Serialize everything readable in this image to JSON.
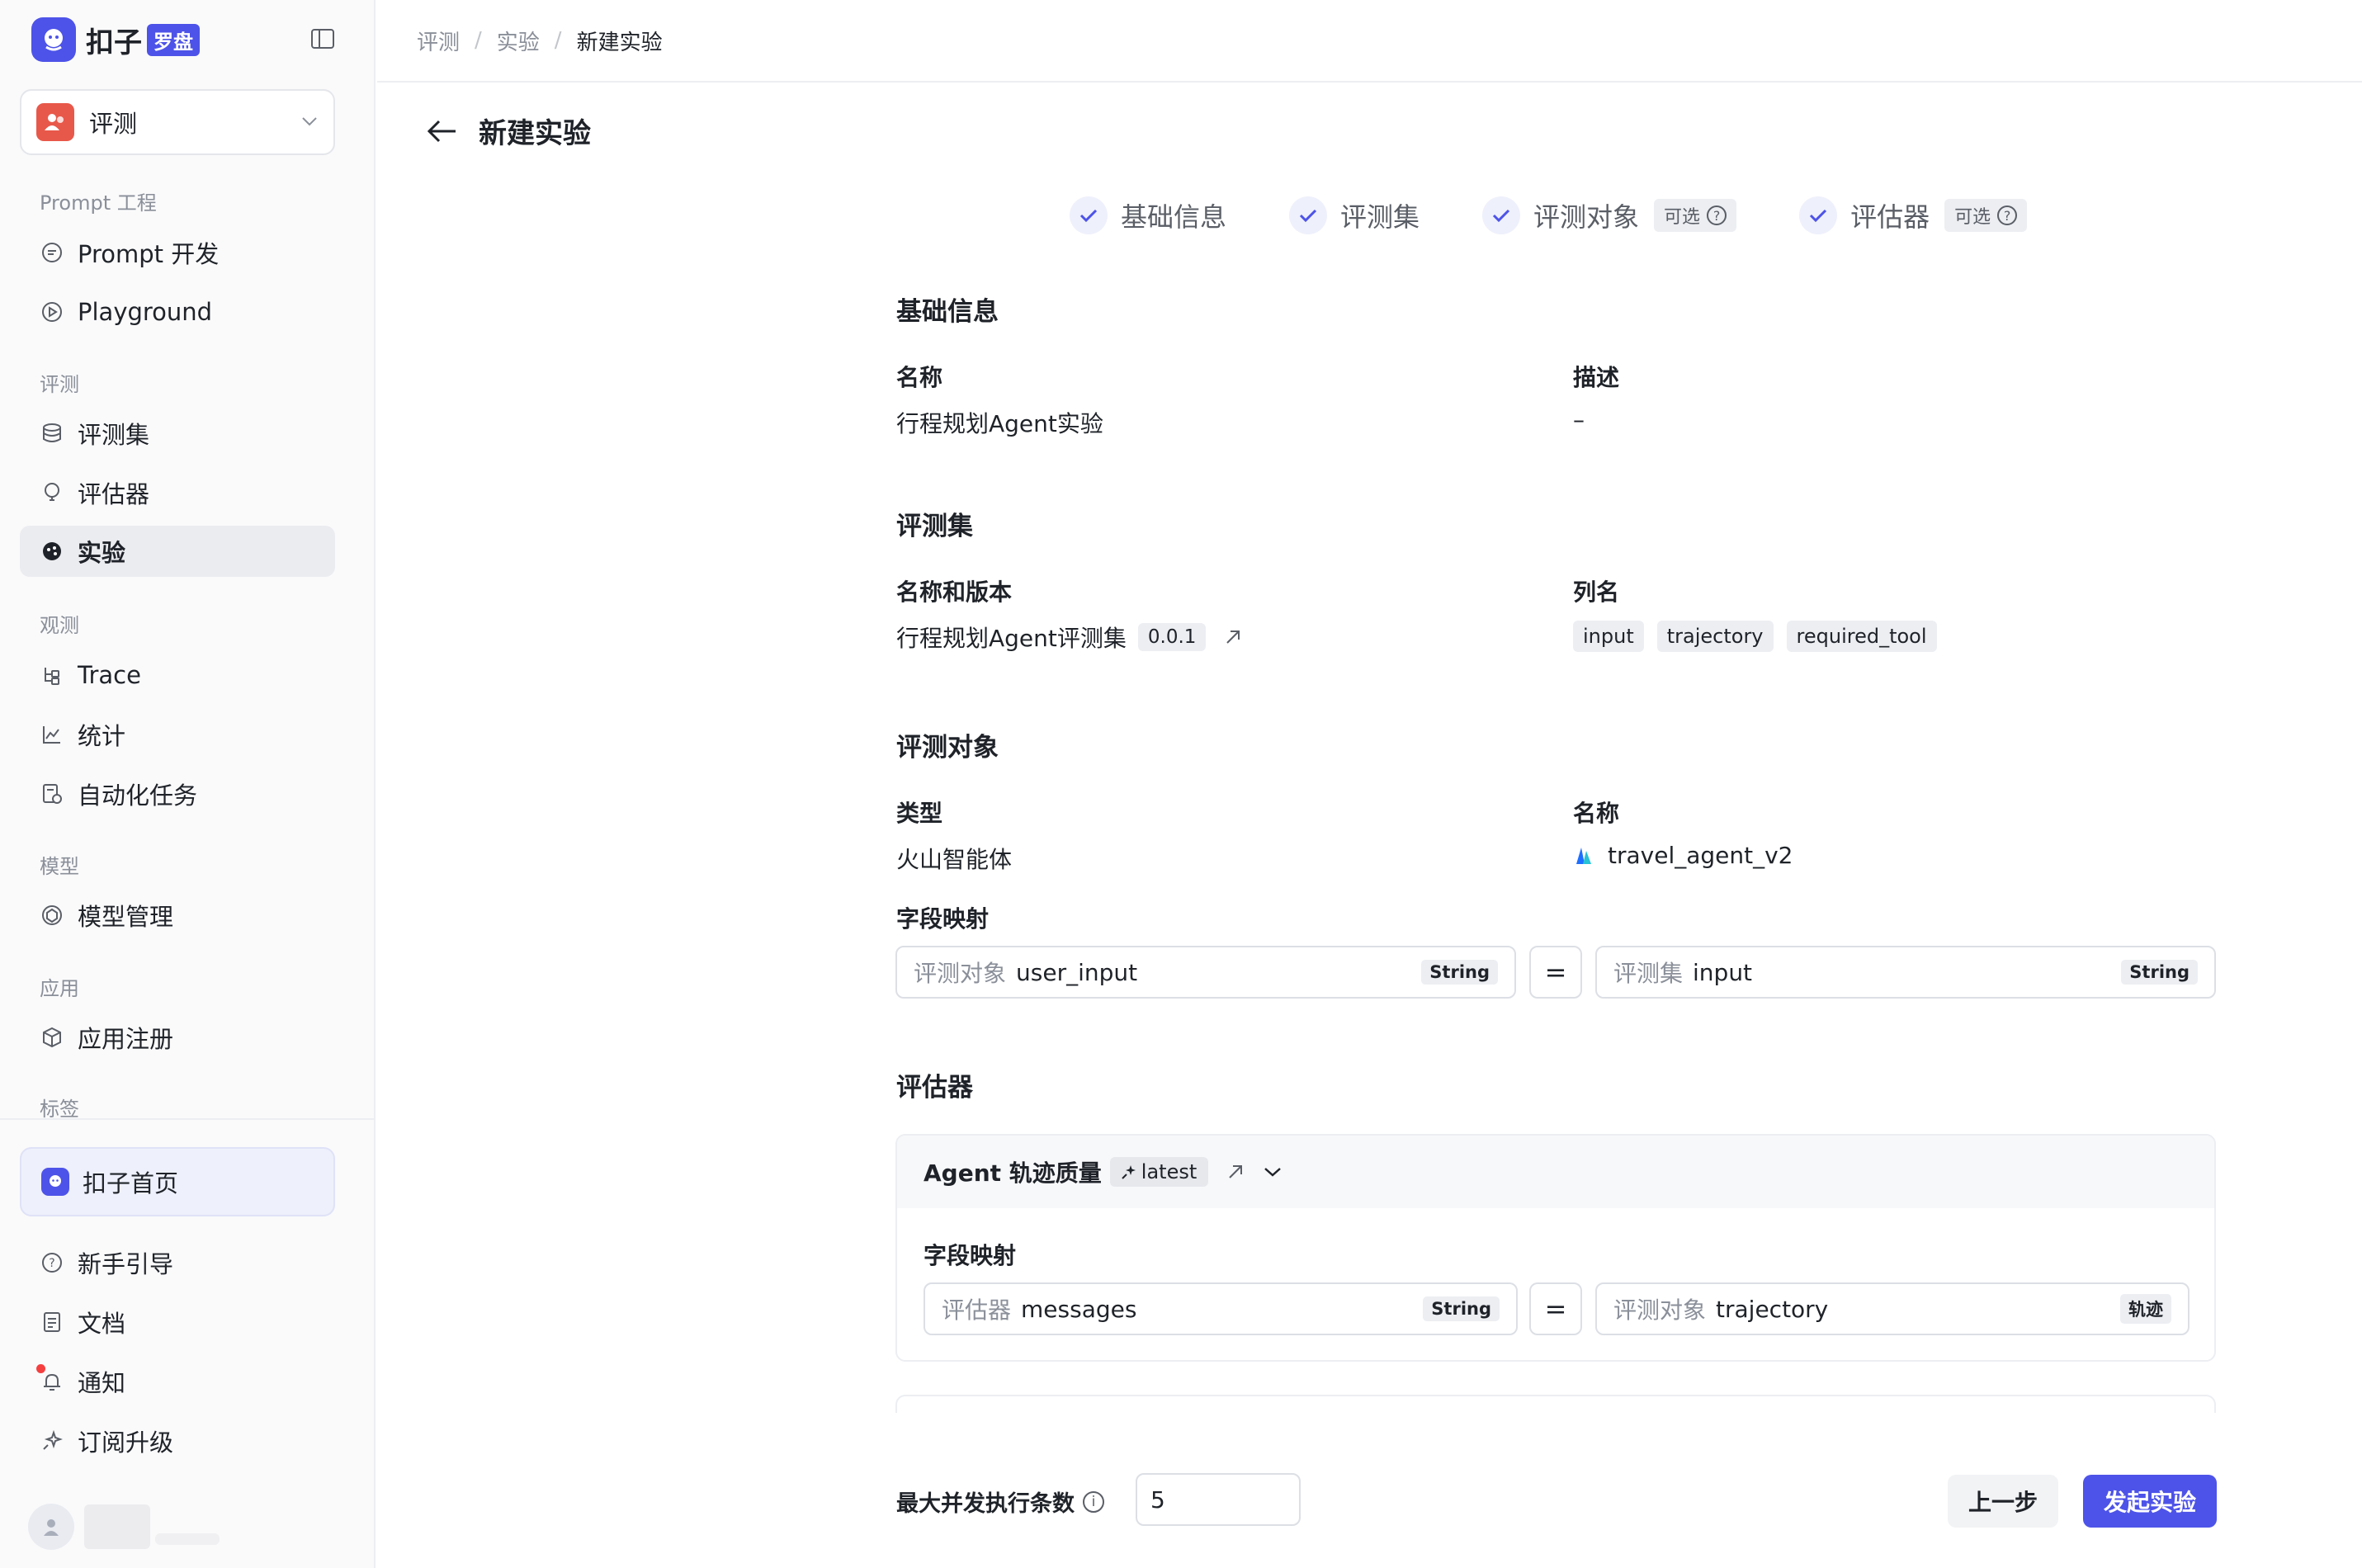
{
  "brand": {
    "name": "扣子",
    "badge": "罗盘"
  },
  "space": {
    "name": "评测"
  },
  "sidebar": {
    "groups": {
      "prompt": "Prompt 工程",
      "eval": "评测",
      "observe": "观测",
      "model": "模型",
      "app": "应用",
      "tag": "标签"
    },
    "items": {
      "prompt_dev": "Prompt 开发",
      "playground": "Playground",
      "eval_set": "评测集",
      "evaluator": "评估器",
      "experiment": "实验",
      "trace": "Trace",
      "stats": "统计",
      "auto_task": "自动化任务",
      "model_mgmt": "模型管理",
      "app_register": "应用注册"
    },
    "home": "扣子首页",
    "bottom": {
      "guide": "新手引导",
      "docs": "文档",
      "notify": "通知",
      "upgrade": "订阅升级"
    }
  },
  "breadcrumb": [
    "评测",
    "实验",
    "新建实验"
  ],
  "page": {
    "title": "新建实验"
  },
  "steps": [
    {
      "label": "基础信息"
    },
    {
      "label": "评测集"
    },
    {
      "label": "评测对象",
      "tag": "可选"
    },
    {
      "label": "评估器",
      "tag": "可选"
    }
  ],
  "basic": {
    "title": "基础信息",
    "name_label": "名称",
    "name_value": "行程规划Agent实验",
    "desc_label": "描述",
    "desc_value": "–"
  },
  "dataset": {
    "title": "评测集",
    "name_label": "名称和版本",
    "name_value": "行程规划Agent评测集",
    "version": "0.0.1",
    "columns_label": "列名",
    "columns": [
      "input",
      "trajectory",
      "required_tool"
    ]
  },
  "target": {
    "title": "评测对象",
    "type_label": "类型",
    "type_value": "火山智能体",
    "name_label": "名称",
    "name_value": "travel_agent_v2",
    "mapping_label": "字段映射",
    "mapping": {
      "left_prefix": "评测对象",
      "left_field": "user_input",
      "left_type": "String",
      "eq": "=",
      "right_prefix": "评测集",
      "right_field": "input",
      "right_type": "String"
    }
  },
  "evaluator": {
    "title": "评估器",
    "card": {
      "name": "Agent 轨迹质量",
      "version": "latest",
      "mapping_label": "字段映射",
      "mapping": {
        "left_prefix": "评估器",
        "left_field": "messages",
        "left_type": "String",
        "eq": "=",
        "right_prefix": "评测对象",
        "right_field": "trajectory",
        "right_type": "轨迹"
      }
    }
  },
  "footer": {
    "concurrency_label": "最大并发执行条数",
    "concurrency_value": "5",
    "prev": "上一步",
    "start": "发起实验"
  },
  "colors": {
    "accent": "#4d53e8",
    "space_avatar": "#e8584a",
    "notify_dot": "#f53f3f"
  }
}
